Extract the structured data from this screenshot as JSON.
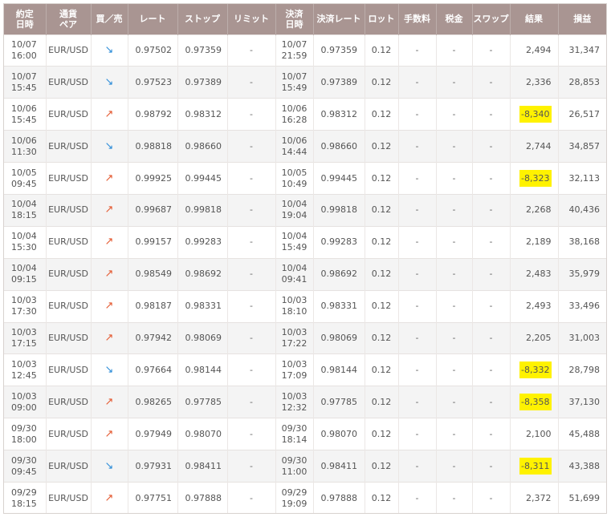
{
  "columns": [
    "約定\n日時",
    "通貨\nペア",
    "買／売",
    "レート",
    "ストップ",
    "リミット",
    "決済\n日時",
    "決済レート",
    "ロット",
    "手数料",
    "税金",
    "スワップ",
    "結果",
    "損益"
  ],
  "rows": [
    {
      "open_time": "10/07\n16:00",
      "pair": "EUR/USD",
      "direction": "sell",
      "arrow": "↘",
      "rate": "0.97502",
      "stop": "0.97359",
      "limit": "-",
      "close_time": "10/07\n21:59",
      "close_rate": "0.97359",
      "lot": "0.12",
      "fee": "-",
      "tax": "-",
      "swap": "-",
      "result": "2,494",
      "result_highlight": false,
      "pnl": "31,347"
    },
    {
      "open_time": "10/07\n15:45",
      "pair": "EUR/USD",
      "direction": "sell",
      "arrow": "↘",
      "rate": "0.97523",
      "stop": "0.97389",
      "limit": "-",
      "close_time": "10/07\n15:49",
      "close_rate": "0.97389",
      "lot": "0.12",
      "fee": "-",
      "tax": "-",
      "swap": "-",
      "result": "2,336",
      "result_highlight": false,
      "pnl": "28,853"
    },
    {
      "open_time": "10/06\n15:45",
      "pair": "EUR/USD",
      "direction": "buy",
      "arrow": "↗",
      "rate": "0.98792",
      "stop": "0.98312",
      "limit": "-",
      "close_time": "10/06\n16:28",
      "close_rate": "0.98312",
      "lot": "0.12",
      "fee": "-",
      "tax": "-",
      "swap": "-",
      "result": "-8,340",
      "result_highlight": true,
      "pnl": "26,517"
    },
    {
      "open_time": "10/06\n11:30",
      "pair": "EUR/USD",
      "direction": "sell",
      "arrow": "↘",
      "rate": "0.98818",
      "stop": "0.98660",
      "limit": "-",
      "close_time": "10/06\n14:44",
      "close_rate": "0.98660",
      "lot": "0.12",
      "fee": "-",
      "tax": "-",
      "swap": "-",
      "result": "2,744",
      "result_highlight": false,
      "pnl": "34,857"
    },
    {
      "open_time": "10/05\n09:45",
      "pair": "EUR/USD",
      "direction": "buy",
      "arrow": "↗",
      "rate": "0.99925",
      "stop": "0.99445",
      "limit": "-",
      "close_time": "10/05\n10:49",
      "close_rate": "0.99445",
      "lot": "0.12",
      "fee": "-",
      "tax": "-",
      "swap": "-",
      "result": "-8,323",
      "result_highlight": true,
      "pnl": "32,113"
    },
    {
      "open_time": "10/04\n18:15",
      "pair": "EUR/USD",
      "direction": "buy",
      "arrow": "↗",
      "rate": "0.99687",
      "stop": "0.99818",
      "limit": "-",
      "close_time": "10/04\n19:04",
      "close_rate": "0.99818",
      "lot": "0.12",
      "fee": "-",
      "tax": "-",
      "swap": "-",
      "result": "2,268",
      "result_highlight": false,
      "pnl": "40,436"
    },
    {
      "open_time": "10/04\n15:30",
      "pair": "EUR/USD",
      "direction": "buy",
      "arrow": "↗",
      "rate": "0.99157",
      "stop": "0.99283",
      "limit": "-",
      "close_time": "10/04\n15:49",
      "close_rate": "0.99283",
      "lot": "0.12",
      "fee": "-",
      "tax": "-",
      "swap": "-",
      "result": "2,189",
      "result_highlight": false,
      "pnl": "38,168"
    },
    {
      "open_time": "10/04\n09:15",
      "pair": "EUR/USD",
      "direction": "buy",
      "arrow": "↗",
      "rate": "0.98549",
      "stop": "0.98692",
      "limit": "-",
      "close_time": "10/04\n09:41",
      "close_rate": "0.98692",
      "lot": "0.12",
      "fee": "-",
      "tax": "-",
      "swap": "-",
      "result": "2,483",
      "result_highlight": false,
      "pnl": "35,979"
    },
    {
      "open_time": "10/03\n17:30",
      "pair": "EUR/USD",
      "direction": "buy",
      "arrow": "↗",
      "rate": "0.98187",
      "stop": "0.98331",
      "limit": "-",
      "close_time": "10/03\n18:10",
      "close_rate": "0.98331",
      "lot": "0.12",
      "fee": "-",
      "tax": "-",
      "swap": "-",
      "result": "2,493",
      "result_highlight": false,
      "pnl": "33,496"
    },
    {
      "open_time": "10/03\n17:15",
      "pair": "EUR/USD",
      "direction": "buy",
      "arrow": "↗",
      "rate": "0.97942",
      "stop": "0.98069",
      "limit": "-",
      "close_time": "10/03\n17:22",
      "close_rate": "0.98069",
      "lot": "0.12",
      "fee": "-",
      "tax": "-",
      "swap": "-",
      "result": "2,205",
      "result_highlight": false,
      "pnl": "31,003"
    },
    {
      "open_time": "10/03\n12:45",
      "pair": "EUR/USD",
      "direction": "sell",
      "arrow": "↘",
      "rate": "0.97664",
      "stop": "0.98144",
      "limit": "-",
      "close_time": "10/03\n17:09",
      "close_rate": "0.98144",
      "lot": "0.12",
      "fee": "-",
      "tax": "-",
      "swap": "-",
      "result": "-8,332",
      "result_highlight": true,
      "pnl": "28,798"
    },
    {
      "open_time": "10/03\n09:00",
      "pair": "EUR/USD",
      "direction": "buy",
      "arrow": "↗",
      "rate": "0.98265",
      "stop": "0.97785",
      "limit": "-",
      "close_time": "10/03\n12:32",
      "close_rate": "0.97785",
      "lot": "0.12",
      "fee": "-",
      "tax": "-",
      "swap": "-",
      "result": "-8,358",
      "result_highlight": true,
      "pnl": "37,130"
    },
    {
      "open_time": "09/30\n18:00",
      "pair": "EUR/USD",
      "direction": "buy",
      "arrow": "↗",
      "rate": "0.97949",
      "stop": "0.98070",
      "limit": "-",
      "close_time": "09/30\n18:14",
      "close_rate": "0.98070",
      "lot": "0.12",
      "fee": "-",
      "tax": "-",
      "swap": "-",
      "result": "2,100",
      "result_highlight": false,
      "pnl": "45,488"
    },
    {
      "open_time": "09/30\n09:45",
      "pair": "EUR/USD",
      "direction": "sell",
      "arrow": "↘",
      "rate": "0.97931",
      "stop": "0.98411",
      "limit": "-",
      "close_time": "09/30\n11:00",
      "close_rate": "0.98411",
      "lot": "0.12",
      "fee": "-",
      "tax": "-",
      "swap": "-",
      "result": "-8,311",
      "result_highlight": true,
      "pnl": "43,388"
    },
    {
      "open_time": "09/29\n18:15",
      "pair": "EUR/USD",
      "direction": "buy",
      "arrow": "↗",
      "rate": "0.97751",
      "stop": "0.97888",
      "limit": "-",
      "close_time": "09/29\n19:09",
      "close_rate": "0.97888",
      "lot": "0.12",
      "fee": "-",
      "tax": "-",
      "swap": "-",
      "result": "2,372",
      "result_highlight": false,
      "pnl": "51,699"
    }
  ],
  "colors": {
    "header_bg": "#a99592",
    "header_text": "#ffffff",
    "arrow_sell": "#2a8bd8",
    "arrow_buy": "#e4572e",
    "highlight": "#fff200"
  }
}
